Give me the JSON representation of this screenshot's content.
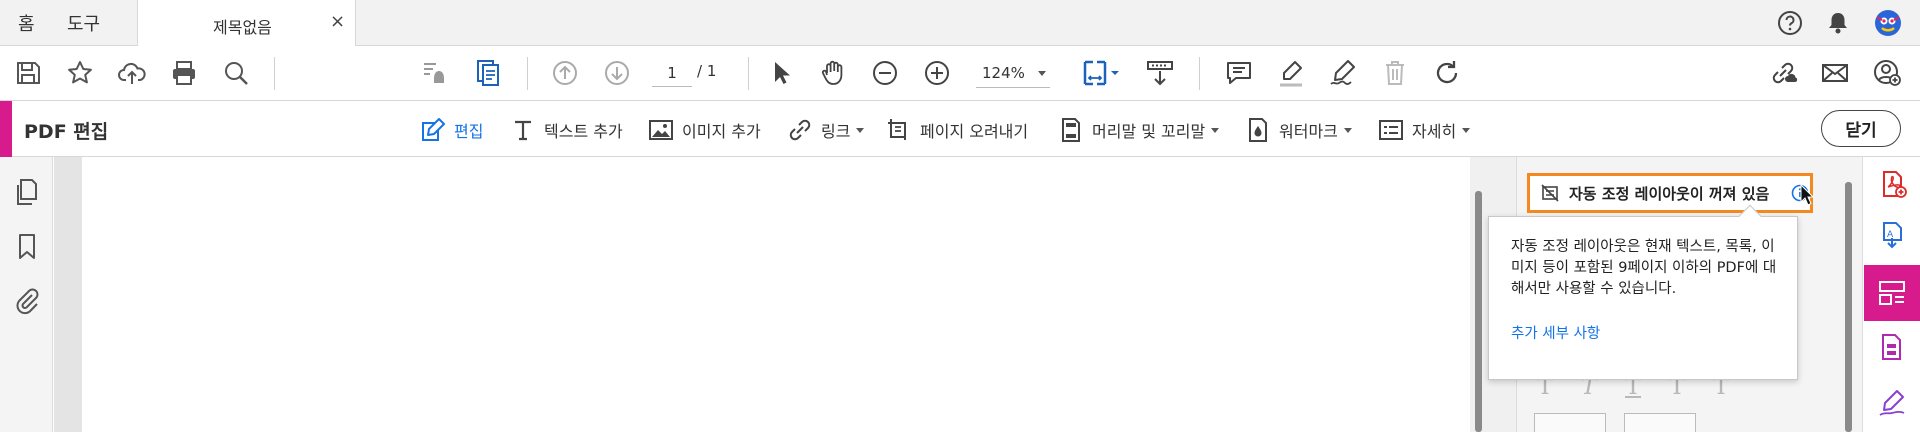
{
  "tabs": {
    "home": "홈",
    "tools": "도구",
    "document": "제목없음",
    "close_glyph": "×"
  },
  "header_icons": [
    "help-icon",
    "bell-icon",
    "avatar"
  ],
  "toolbar": {
    "page_current": "1",
    "page_total": "/ 1",
    "zoom": "124%",
    "icons": [
      "save-icon",
      "bookmark-star-icon",
      "upload-cloud-icon",
      "print-icon",
      "search-zoom-icon",
      "read-mode-icon",
      "export-page-icon",
      "prev-page-icon",
      "next-page-icon",
      "select-pointer-icon",
      "hand-icon",
      "zoom-out-icon",
      "zoom-in-icon",
      "fit-page-icon",
      "scroll-mode-icon",
      "comment-icon",
      "highlight-icon",
      "sign-icon",
      "delete-icon",
      "rotate-icon",
      "share-link-icon",
      "email-icon",
      "add-user-icon"
    ]
  },
  "edit_bar": {
    "title": "PDF 편집",
    "close_button": "닫기",
    "tools": [
      {
        "label": "편집",
        "icon": "edit-icon",
        "active": true,
        "dropdown": false
      },
      {
        "label": "텍스트 추가",
        "icon": "add-text-icon",
        "active": false,
        "dropdown": false
      },
      {
        "label": "이미지 추가",
        "icon": "add-image-icon",
        "active": false,
        "dropdown": false
      },
      {
        "label": "링크",
        "icon": "link-icon",
        "active": false,
        "dropdown": true
      },
      {
        "label": "페이지 오려내기",
        "icon": "crop-icon",
        "active": false,
        "dropdown": false
      },
      {
        "label": "머리말 및 꼬리말",
        "icon": "header-footer-icon",
        "active": false,
        "dropdown": true
      },
      {
        "label": "워터마크",
        "icon": "watermark-icon",
        "active": false,
        "dropdown": true
      },
      {
        "label": "자세히",
        "icon": "more-icon",
        "active": false,
        "dropdown": true
      }
    ]
  },
  "left_rail": [
    "pages-icon",
    "bookmark-icon",
    "attachment-icon"
  ],
  "right_panel": {
    "autofit_label": "자동 조정 레이아웃이 꺼져 있음",
    "tooltip_text": "자동 조정 레이아웃은 현재 텍스트, 목록, 이미지 등이 포함된 9페이지 이하의 PDF에 대해서만 사용할 수 있습니다.",
    "tooltip_link": "추가 세부 사항"
  },
  "tool_rail": [
    "create-pdf-icon",
    "export-pdf-icon",
    "edit-pdf-icon",
    "organize-pages-icon",
    "fill-sign-icon"
  ],
  "colors": {
    "accent": "#d81b8c",
    "link": "#1473e6",
    "highlight_border": "#f5891f"
  }
}
